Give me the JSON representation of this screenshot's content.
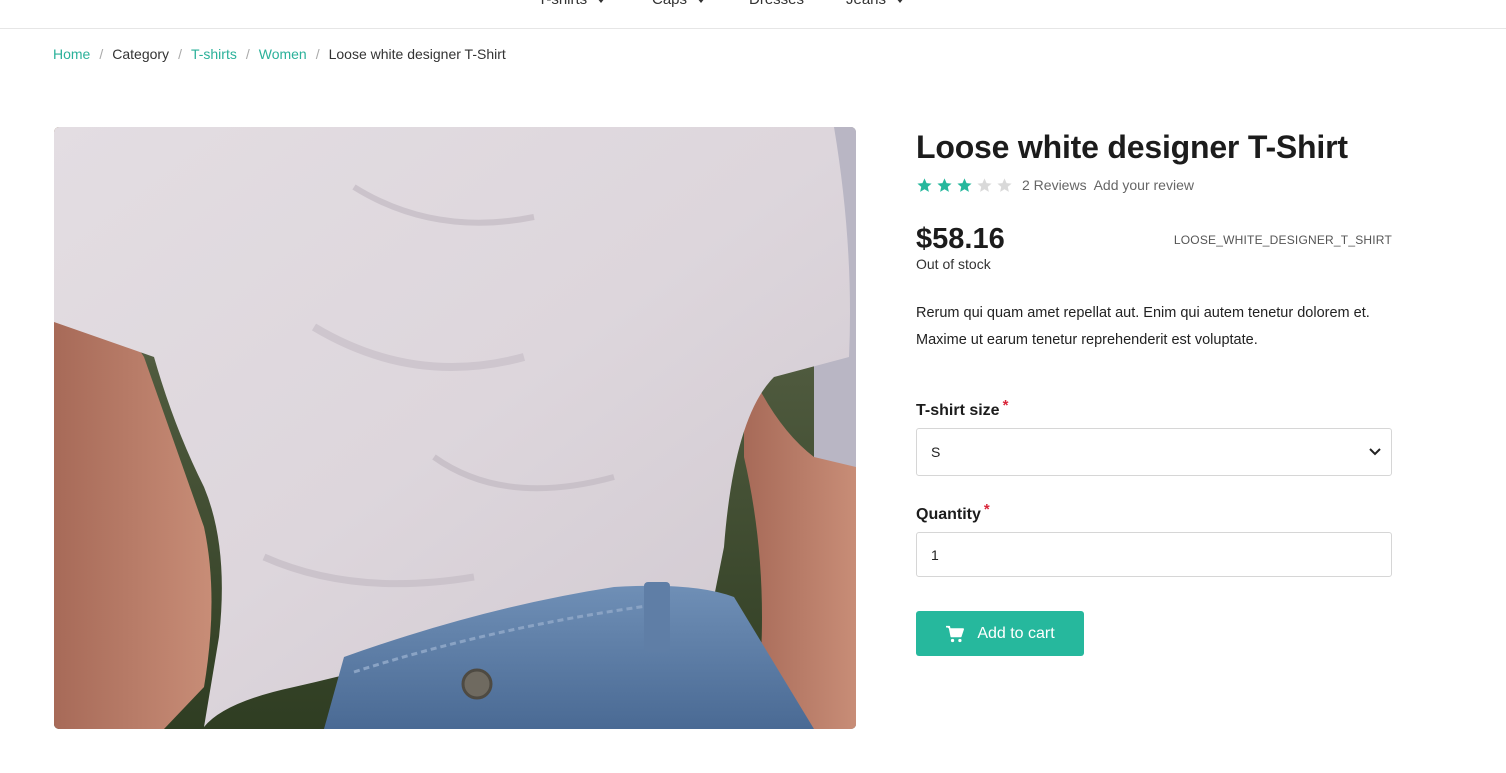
{
  "top_nav": [
    {
      "label": "T-shirts",
      "has_caret": true
    },
    {
      "label": "Caps",
      "has_caret": true
    },
    {
      "label": "Dresses",
      "has_caret": false
    },
    {
      "label": "Jeans",
      "has_caret": true
    }
  ],
  "breadcrumb": {
    "home": "Home",
    "category": "Category",
    "tshirts": "T-shirts",
    "women": "Women",
    "current": "Loose white designer T-Shirt",
    "separator": "/"
  },
  "product": {
    "title": "Loose white designer T-Shirt",
    "rating": 3,
    "rating_max": 5,
    "reviews_label": "2 Reviews",
    "add_review_label": "Add your review",
    "price": "$58.16",
    "sku": "LOOSE_WHITE_DESIGNER_T_SHIRT",
    "stock_status": "Out of stock",
    "description": "Rerum qui quam amet repellat aut. Enim qui autem tenetur dolorem et. Maxime ut earum tenetur reprehenderit est voluptate."
  },
  "options": {
    "size_label": "T-shirt size",
    "size_value": "S",
    "quantity_label": "Quantity",
    "quantity_value": "1",
    "required_mark": "*"
  },
  "cart": {
    "button_label": "Add to cart"
  },
  "colors": {
    "accent": "#26b89d",
    "link": "#2bb19a",
    "required": "#d9263a",
    "star_filled": "#26b89d",
    "star_empty": "#d9d9d9"
  }
}
